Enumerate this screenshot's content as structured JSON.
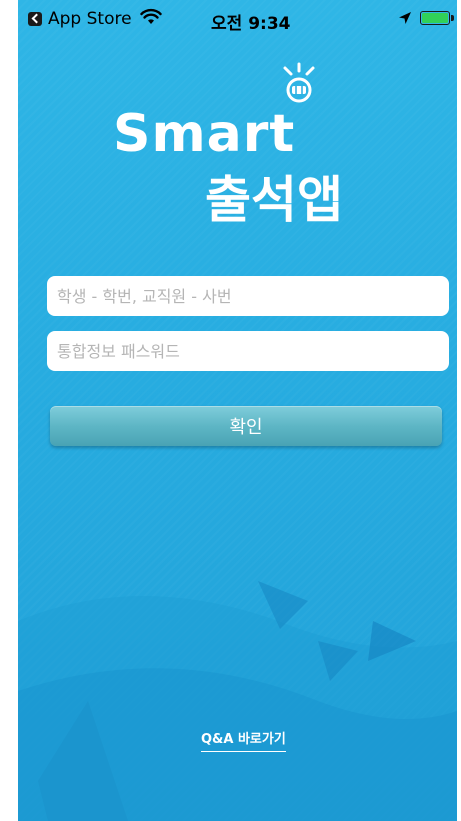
{
  "status_bar": {
    "back_app": "App Store",
    "time": "오전 9:34"
  },
  "logo": {
    "line1": "Smart",
    "line2": "출석앱"
  },
  "login": {
    "id_placeholder": "학생 - 학번, 교직원 - 사번",
    "password_placeholder": "통합정보 패스워드",
    "confirm_label": "확인"
  },
  "footer": {
    "qa_link": "Q&A 바로가기"
  },
  "colors": {
    "background": "#27ace0",
    "button": "#5eb6c5",
    "battery": "#31d158"
  },
  "icons": [
    "back-arrow-icon",
    "wifi-icon",
    "location-arrow-icon",
    "battery-icon",
    "lightbulb-icon"
  ]
}
